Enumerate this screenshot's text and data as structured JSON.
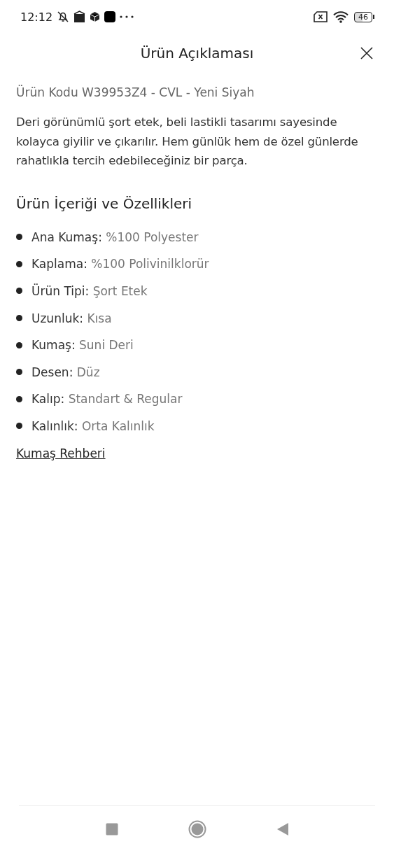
{
  "status_bar": {
    "time": "12:12",
    "battery": "46"
  },
  "header": {
    "title": "Ürün Açıklaması"
  },
  "product_code": "Ürün Kodu W39953Z4 - CVL - Yeni Siyah",
  "description": "Deri görünümlü şort etek, beli lastikli tasarımı sayesinde kolayca giyilir ve çıkarılır. Hem günlük hem de özel günlerde rahatlıkla tercih edebileceğiniz bir parça.",
  "features": {
    "heading": "Ürün İçeriği ve Özellikleri",
    "items": [
      {
        "label": "Ana Kumaş:",
        "value": "%100 Polyester"
      },
      {
        "label": "Kaplama:",
        "value": "%100 Polivinilklorür"
      },
      {
        "label": "Ürün Tipi:",
        "value": "Şort Etek"
      },
      {
        "label": "Uzunluk:",
        "value": "Kısa"
      },
      {
        "label": "Kumaş:",
        "value": "Suni Deri"
      },
      {
        "label": "Desen:",
        "value": "Düz"
      },
      {
        "label": "Kalıp:",
        "value": "Standart & Regular"
      },
      {
        "label": "Kalınlık:",
        "value": "Orta Kalınlık"
      }
    ]
  },
  "link": "Kumaş Rehberi"
}
